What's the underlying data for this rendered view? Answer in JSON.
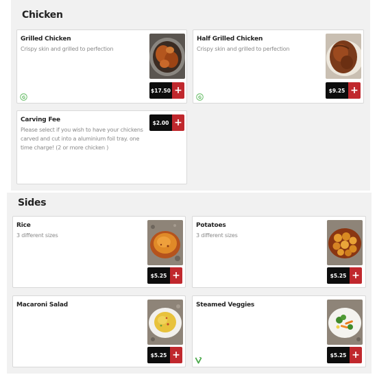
{
  "sections": [
    {
      "title": "Chicken",
      "items": [
        {
          "name": "Grilled Chicken",
          "description": "Crispy skin and grilled to perfection",
          "price": "$17.50",
          "add": "+",
          "image": "grilled-chicken-photo",
          "badge": "gluten-free-icon"
        },
        {
          "name": "Half Grilled Chicken",
          "description": "Crispy skin and grilled to perfection",
          "price": "$9.25",
          "add": "+",
          "image": "half-grilled-chicken-photo",
          "badge": "gluten-free-icon"
        },
        {
          "name": "Carving Fee",
          "description": "Please select if you wish to have your chickens carved and cut into a aluminium foil tray. one time charge! (2 or more chicken )",
          "price": "$2.00",
          "add": "+"
        }
      ]
    },
    {
      "title": "Sides",
      "items": [
        {
          "name": "Rice",
          "description": "3 different sizes",
          "price": "$5.25",
          "add": "+",
          "image": "rice-photo"
        },
        {
          "name": "Potatoes",
          "description": "3 different sizes",
          "price": "$5.25",
          "add": "+",
          "image": "potatoes-photo"
        },
        {
          "name": "Macaroni Salad",
          "description": "",
          "price": "$5.25",
          "add": "+",
          "image": "macaroni-salad-photo"
        },
        {
          "name": "Steamed Veggies",
          "description": "",
          "price": "$5.25",
          "add": "+",
          "image": "steamed-veggies-photo",
          "badge": "vegan-icon"
        }
      ]
    }
  ],
  "colors": {
    "price_bg": "#0d0d0d",
    "add_bg": "#c0282d",
    "section_bg": "#f1f1f1",
    "badge_green": "#5cb85c"
  }
}
